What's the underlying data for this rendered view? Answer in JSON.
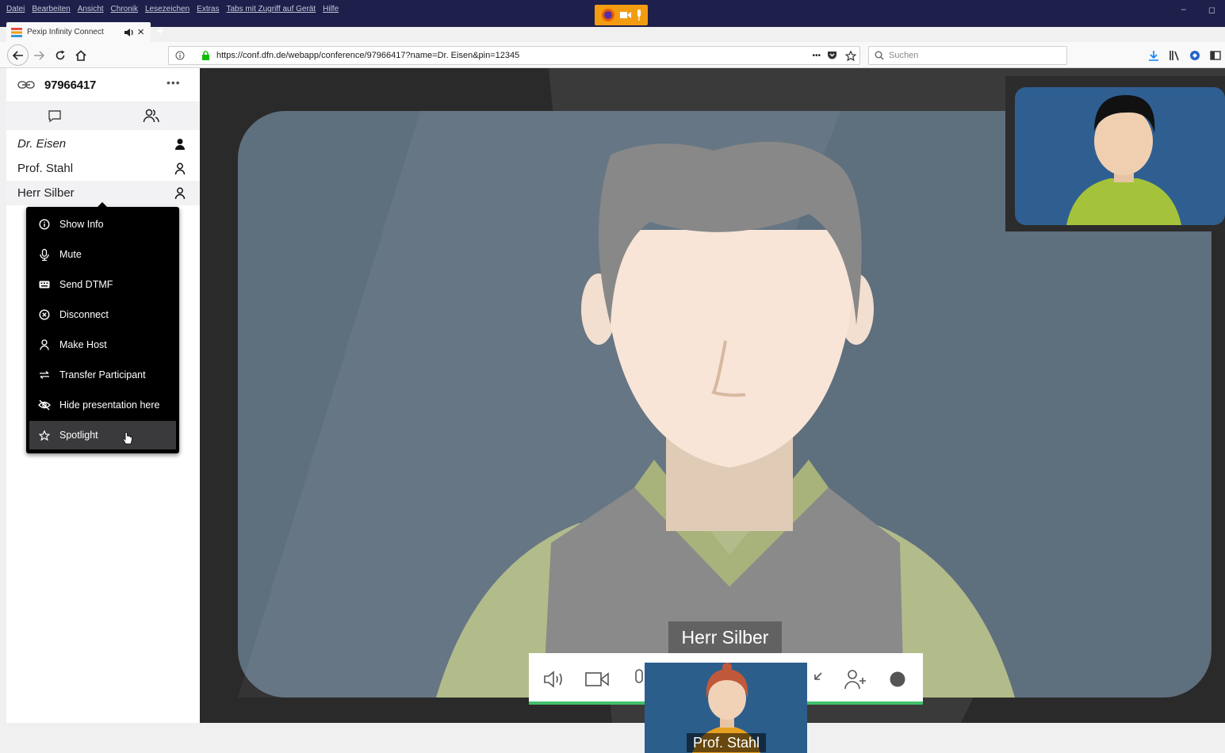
{
  "window": {
    "menu": [
      "Datei",
      "Bearbeiten",
      "Ansicht",
      "Chronik",
      "Lesezeichen",
      "Extras",
      "Tabs mit Zugriff auf Gerät",
      "Hilfe"
    ],
    "controls": [
      "–",
      "◻"
    ]
  },
  "tab": {
    "title": "Pexip Infinity Connect",
    "close": "×",
    "new_tab": "+"
  },
  "nav": {
    "url": "https://conf.dfn.de/webapp/conference/97966417?name=Dr. Eisen&pin=12345",
    "search_placeholder": "Suchen",
    "more": "•••"
  },
  "conference": {
    "id": "97966417",
    "more": "•••",
    "participants": [
      {
        "name": "Dr. Eisen"
      },
      {
        "name": "Prof. Stahl"
      },
      {
        "name": "Herr Silber"
      }
    ]
  },
  "context_menu": {
    "items": [
      {
        "label": "Show Info",
        "icon": "info-icon"
      },
      {
        "label": "Mute",
        "icon": "microphone-icon"
      },
      {
        "label": "Send DTMF",
        "icon": "keyboard-icon"
      },
      {
        "label": "Disconnect",
        "icon": "close-circle-icon"
      },
      {
        "label": "Make Host",
        "icon": "person-icon"
      },
      {
        "label": "Transfer Participant",
        "icon": "transfer-icon"
      },
      {
        "label": "Hide presentation here",
        "icon": "eye-off-icon"
      },
      {
        "label": "Spotlight",
        "icon": "star-icon"
      }
    ]
  },
  "video": {
    "speaker_name": "Herr Silber",
    "pip_name": "Prof. Stahl"
  },
  "colors": {
    "titlebar": "#1e1f4a",
    "toolbar_accent": "#43c06b",
    "video_bg": "#5e6f7e"
  }
}
